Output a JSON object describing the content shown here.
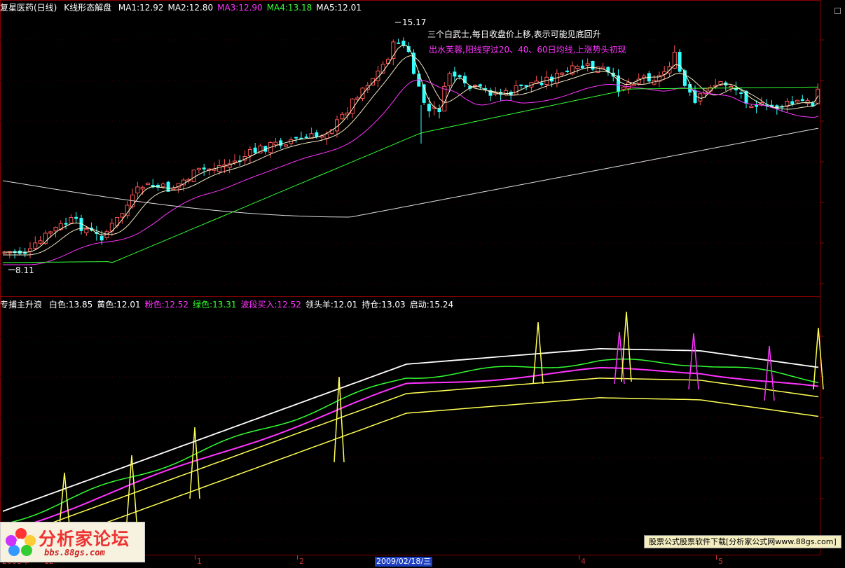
{
  "top_header": {
    "stock": "复星医药(日线)",
    "indicator": "K线形态解盘",
    "items": [
      {
        "label": "MA1:12.92",
        "color": "#ffffff"
      },
      {
        "label": "MA2:12.80",
        "color": "#ffffff"
      },
      {
        "label": "MA3:12.90",
        "color": "#ff33ff"
      },
      {
        "label": "MA4:13.18",
        "color": "#33ff33"
      },
      {
        "label": "MA5:12.01",
        "color": "#ffffff"
      }
    ]
  },
  "annotations": {
    "high_label": "15.17",
    "low_label": "8.11",
    "note1": "三个白武士,每日收盘价上移,表示可能见底回升",
    "note2": "出水芙蓉,阳线穿过20、40、60日均线,上涨势头初现"
  },
  "bottom_header": {
    "name": "专捕主升浪",
    "items": [
      {
        "label": "白色:13.85",
        "color": "#ffffff"
      },
      {
        "label": "黄色:12.01",
        "color": "#ffffff"
      },
      {
        "label": "粉色:12.52",
        "color": "#ff33ff"
      },
      {
        "label": "绿色:13.31",
        "color": "#33ff33"
      },
      {
        "label": "波段买入:12.52",
        "color": "#ff33ff"
      },
      {
        "label": "领头羊:12.01",
        "color": "#ffffff"
      },
      {
        "label": "持仓:13.03",
        "color": "#ffffff"
      },
      {
        "label": "启动:15.24",
        "color": "#ffffff"
      }
    ]
  },
  "date_axis": {
    "ticks": [
      {
        "label": "2008年"
      },
      {
        "label": "12"
      },
      {
        "label": "1"
      },
      {
        "label": "2"
      },
      {
        "label": "4"
      },
      {
        "label": "5"
      }
    ],
    "current_date": "2009/02/18/三"
  },
  "watermark": {
    "logo_title": "分析家论坛",
    "logo_url": "bbs.88gs.com",
    "banner": "股票公式股票软件下载[分析家公式网www.88gs.com]"
  },
  "colors": {
    "up": "#ff5555",
    "down": "#33ffff",
    "grid": "#8b0000",
    "white_line": "#ffffff",
    "yellow_line": "#ffff55",
    "pink_line": "#ff33ff",
    "green_line": "#33ff33"
  }
}
